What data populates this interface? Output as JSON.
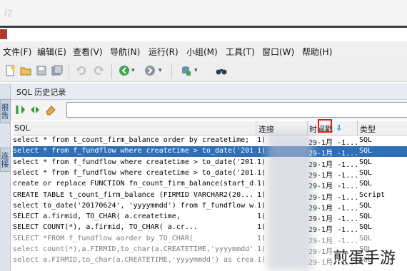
{
  "window": {
    "title_fragment": "/2"
  },
  "menu": [
    "文件(F)",
    "编辑(E)",
    "查看(V)",
    "导航(N)",
    "运行(R)",
    "小组(M)",
    "工具(T)",
    "窗口(W)",
    "帮助(H)"
  ],
  "left_tabs": [
    "报告",
    "连接"
  ],
  "panel": {
    "title": "SQL 历史记录",
    "filter_value": ""
  },
  "grid": {
    "columns": [
      "SQL",
      "连接",
      "时间戳",
      "类型"
    ],
    "sort_indicator": "⇩",
    "rows": [
      {
        "sql": "select * from t_count_firm_balance order by createtime;",
        "conn": "1(",
        "time": "29-1月 -1...",
        "type": "SQL",
        "selected": false
      },
      {
        "sql": "select * from f_fundflow where createtime > to_date('201...",
        "conn": "1(",
        "time": "29-1月 -1...",
        "type": "SQL",
        "selected": true
      },
      {
        "sql": "select * from f_fundflow where createtime > to_date('201...",
        "conn": "1(",
        "time": "29-1月 -1...",
        "type": "SQL",
        "selected": false
      },
      {
        "sql": "select * from f_fundflow where createtime > to_date('201...",
        "conn": "1(",
        "time": "29-1月 -1...",
        "type": "SQL",
        "selected": false
      },
      {
        "sql": "create or replace FUNCTION fn_count_firm_balance(start_d...",
        "conn": "1(",
        "time": "29-1月 -1...",
        "type": "SQL",
        "selected": false
      },
      {
        "sql": "CREATE TABLE t_count_firm_balance     (FIRMID VARCHAR2(20...",
        "conn": "1(",
        "time": "29-1月 -1...",
        "type": "Script",
        "selected": false
      },
      {
        "sql": "select to_date('20170624', 'yyyymmdd') from f_fundflow w...",
        "conn": "1(",
        "time": "29-1月 -1...",
        "type": "SQL",
        "selected": false
      },
      {
        "sql": "SELECT     a.firmid,     TO_CHAR(       a.createtime,",
        "conn": "1(",
        "time": "29-1月 -1...",
        "type": "SQL",
        "selected": false
      },
      {
        "sql": "SELECT     COUNT(*),     a.firmid,     TO_CHAR(     a.cr...",
        "conn": "1(",
        "time": "29-1月 -1...",
        "type": "SQL",
        "selected": false
      },
      {
        "sql": "SELECT *FROM    f_fundflow aorder by    TO_CHAR(",
        "conn": "1(",
        "time": "29-1月 -1...",
        "type": "SQL",
        "selected": false
      },
      {
        "sql": "select count(*),a.FIRMID,to_char(a.CREATETIME,'yyyymmdd'...",
        "conn": "1(",
        "time": "29-1月 -1...",
        "type": "SQL",
        "selected": false
      },
      {
        "sql": "select a.FIRMID,to_char(a.CREATETIME,'yyyymmdd') as crea...",
        "conn": "1(",
        "time": "29-1月 -1...",
        "type": "SQL",
        "selected": false
      }
    ]
  },
  "watermark": "煎蛋手游",
  "colors": {
    "selection": "#2f6fb8",
    "highlight_box": "#d62020"
  }
}
